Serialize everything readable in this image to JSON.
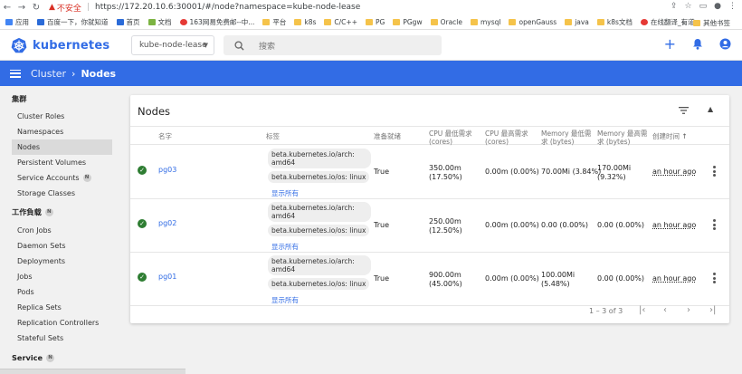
{
  "browser": {
    "insecure_label": "不安全",
    "url": "https://172.20.10.6:30001/#/node?namespace=kube-node-lease",
    "bookmarks": [
      "应用",
      "百度一下，你就知道",
      "首页",
      "文档",
      "163网易免费邮--中...",
      "平台",
      "k8s",
      "C/C++",
      "PG",
      "PGgw",
      "Oracle",
      "mysql",
      "openGauss",
      "java",
      "k8s文档",
      "在线翻译_有道"
    ],
    "other_bookmarks": "其他书签"
  },
  "app": {
    "brand": "kubernetes",
    "namespace": "kube-node-lease",
    "search_placeholder": "搜索"
  },
  "toolbar": {
    "crumb_root": "Cluster",
    "crumb_current": "Nodes"
  },
  "sidebar": {
    "cluster_heading": "集群",
    "cluster_items": [
      "Cluster Roles",
      "Namespaces",
      "Nodes",
      "Persistent Volumes",
      "Service Accounts",
      "Storage Classes"
    ],
    "workloads_heading": "工作負载",
    "workload_items": [
      "Cron Jobs",
      "Daemon Sets",
      "Deployments",
      "Jobs",
      "Pods",
      "Replica Sets",
      "Replication Controllers",
      "Stateful Sets"
    ],
    "service_heading": "Service",
    "badge": "N"
  },
  "card": {
    "title": "Nodes",
    "columns": {
      "name": "名字",
      "labels": "标签",
      "ready": "准备就绪",
      "cpu_req": "CPU 最低需求 (cores)",
      "cpu_lim": "CPU 最高需求 (cores)",
      "mem_req": "Memory 最低需求 (bytes)",
      "mem_lim": "Memory 最高需求 (bytes)",
      "created": "创建时间"
    },
    "rows": [
      {
        "name": "pg03",
        "label1": "beta.kubernetes.io/arch: amd64",
        "label2": "beta.kubernetes.io/os: linux",
        "show_all": "显示所有",
        "ready": "True",
        "cpu_req": "350.00m",
        "cpu_req_pct": "(17.50%)",
        "cpu_lim": "0.00m (0.00%)",
        "mem_req": "70.00Mi (3.84%)",
        "mem_lim": "170.00Mi",
        "mem_lim_pct": "(9.32%)",
        "created": "an hour ago"
      },
      {
        "name": "pg02",
        "label1": "beta.kubernetes.io/arch: amd64",
        "label2": "beta.kubernetes.io/os: linux",
        "show_all": "显示所有",
        "ready": "True",
        "cpu_req": "250.00m",
        "cpu_req_pct": "(12.50%)",
        "cpu_lim": "0.00m (0.00%)",
        "mem_req": "0.00 (0.00%)",
        "mem_lim": "0.00 (0.00%)",
        "mem_lim_pct": "",
        "created": "an hour ago"
      },
      {
        "name": "pg01",
        "label1": "beta.kubernetes.io/arch: amd64",
        "label2": "beta.kubernetes.io/os: linux",
        "show_all": "显示所有",
        "ready": "True",
        "cpu_req": "900.00m",
        "cpu_req_pct": "(45.00%)",
        "cpu_lim": "0.00m (0.00%)",
        "mem_req": "100.00Mi",
        "mem_req_pct": "(5.48%)",
        "mem_lim": "0.00 (0.00%)",
        "mem_lim_pct": "",
        "created": "an hour ago"
      }
    ],
    "pagination": "1 – 3 of 3"
  },
  "colors": {
    "accent": "#326ce5",
    "ready": "#2e7d32"
  }
}
